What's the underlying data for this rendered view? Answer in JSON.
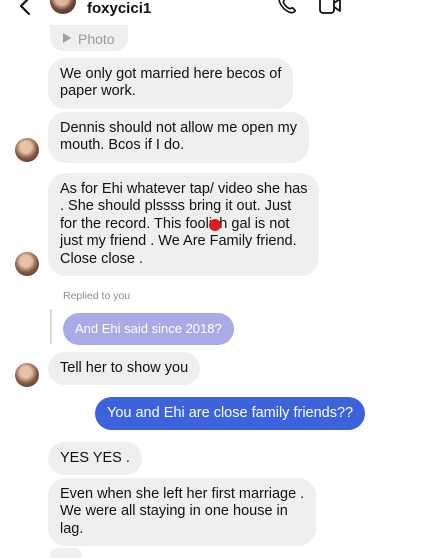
{
  "header": {
    "username": "foxycici1",
    "back_icon": "chevron-left-icon",
    "call_icon": "phone-icon",
    "video_icon": "video-camera-icon"
  },
  "messages": {
    "photo_label": "Photo",
    "m1": "We only got married here becos of\npaper work.",
    "m2": "Dennis should not allow me open my\nmouth. Bcos if I do.",
    "m3": "As for Ehi whatever tap/ video she has\n. She should plssss bring it out. Just\nfor the record. This foolish gal is not\njust my friend . We Are Family friend.\nClose close .",
    "replied_to": "Replied to you",
    "reply_quote": "And Ehi said since 2018?",
    "m4": "Tell her to show you",
    "m5_outgoing": "You and Ehi are close family friends??",
    "m6": "YES YES .",
    "m7": "Even when she left her first marriage .\nWe were all staying in one house in\nlag."
  },
  "colors": {
    "outgoing_bubble": "#3d63dc",
    "incoming_bubble": "#efefef",
    "reply_bubble": "#a9abe7"
  }
}
